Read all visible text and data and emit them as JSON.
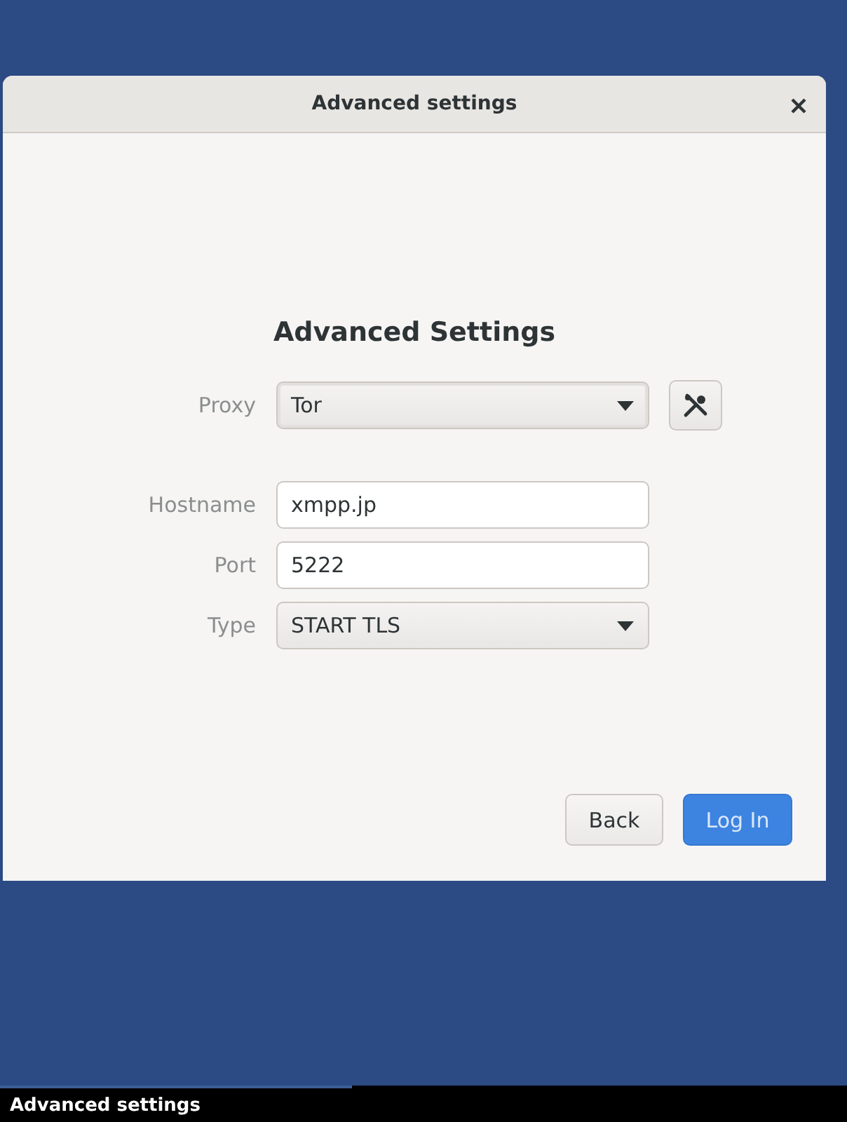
{
  "window": {
    "title": "Advanced settings"
  },
  "heading": "Advanced Settings",
  "fields": [
    {
      "kind": "dropdown",
      "label": "Proxy",
      "value": "Tor",
      "tool_button": true
    },
    {
      "kind": "text",
      "label": "Hostname",
      "value": "xmpp.jp"
    },
    {
      "kind": "text",
      "label": "Port",
      "value": "5222"
    },
    {
      "kind": "dropdown",
      "label": "Type",
      "value": "START TLS"
    }
  ],
  "buttons": [
    {
      "label": "Back",
      "kind": "secondary"
    },
    {
      "label": "Log In",
      "kind": "suggested"
    }
  ],
  "taskbar": {
    "items": [
      {
        "label": "Advanced settings"
      }
    ]
  }
}
